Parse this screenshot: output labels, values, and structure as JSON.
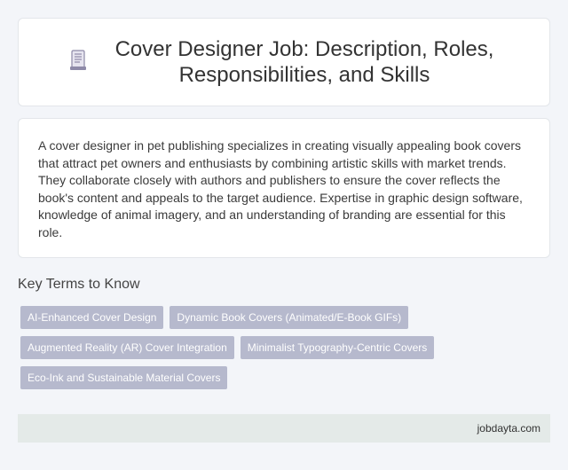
{
  "header": {
    "title": "Cover Designer Job: Description, Roles, Responsibilities, and Skills",
    "icon": "document-icon"
  },
  "description": {
    "text": "A cover designer in pet publishing specializes in creating visually appealing book covers that attract pet owners and enthusiasts by combining artistic skills with market trends. They collaborate closely with authors and publishers to ensure the cover reflects the book's content and appeals to the target audience. Expertise in graphic design software, knowledge of animal imagery, and an understanding of branding are essential for this role."
  },
  "key_terms": {
    "heading": "Key Terms to Know",
    "tags": [
      "AI-Enhanced Cover Design",
      "Dynamic Book Covers (Animated/E-Book GIFs)",
      "Augmented Reality (AR) Cover Integration",
      "Minimalist Typography-Centric Covers",
      "Eco-Ink and Sustainable Material Covers"
    ]
  },
  "footer": {
    "site": "jobdayta.com"
  },
  "colors": {
    "background": "#f3f5f9",
    "tag_bg": "#b6b9cd",
    "footer_bg": "#e4eae8",
    "icon": "#8e8aa8"
  }
}
